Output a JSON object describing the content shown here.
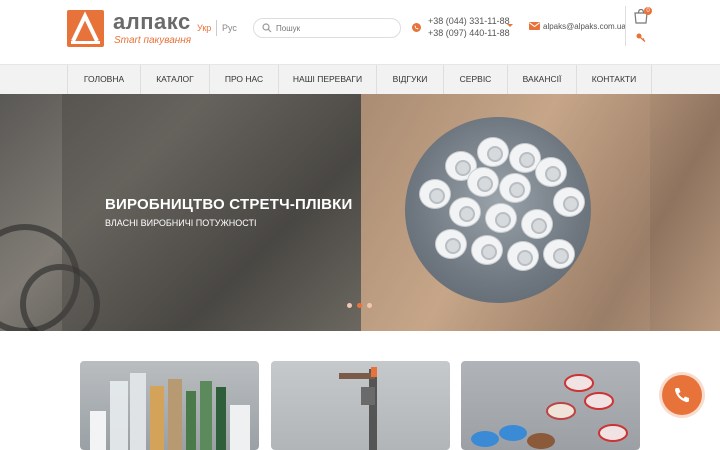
{
  "brand": {
    "name": "алпакс",
    "tagline": "Smart пакування",
    "accent": "#e8733a"
  },
  "languages": {
    "ukr": "Укр",
    "rus": "Рус"
  },
  "search": {
    "placeholder": "Пошук"
  },
  "contacts": {
    "phone1": "+38 (044) 331-11-88",
    "phone2": "+38 (097) 440-11-88",
    "email": "alpaks@alpaks.com.ua"
  },
  "cart": {
    "count": "0"
  },
  "nav": {
    "items": [
      {
        "label": "ГОЛОВНА"
      },
      {
        "label": "КАТАЛОГ"
      },
      {
        "label": "ПРО НАС"
      },
      {
        "label": "НАШІ ПЕРЕВАГИ"
      },
      {
        "label": "ВІДГУКИ"
      },
      {
        "label": "СЕРВІС"
      },
      {
        "label": "ВАКАНСІЇ"
      },
      {
        "label": "КОНТАКТИ"
      }
    ]
  },
  "hero": {
    "title": "ВИРОБНИЦТВО СТРЕТЧ-ПЛІВКИ",
    "subtitle": "ВЛАСНІ ВИРОБНИЧІ ПОТУЖНОСТІ",
    "slides_total": 3,
    "active_slide": 2
  },
  "icons": {
    "search": "search-icon",
    "phone": "phone-icon",
    "mail": "mail-icon",
    "cart": "cart-icon",
    "key": "key-icon",
    "call": "phone-call-icon"
  }
}
